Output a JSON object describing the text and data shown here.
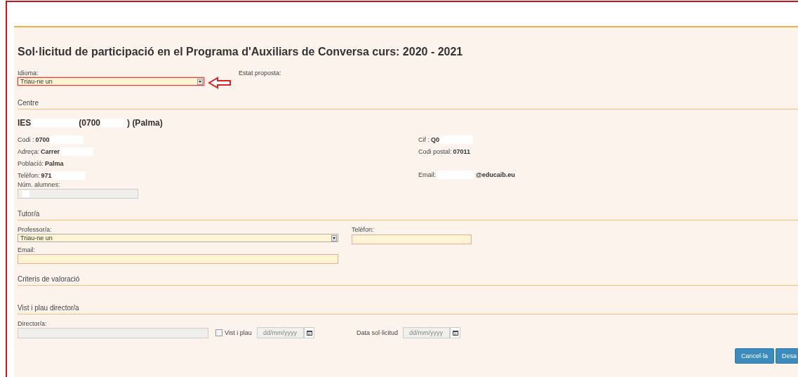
{
  "title": "Sol·licitud de participació en el Programa d'Auxiliars de Conversa curs: 2020 - 2021",
  "idioma": {
    "label": "Idioma:",
    "value": "Triau-ne un",
    "highlighted": true
  },
  "estat": {
    "label": "Estat proposta:"
  },
  "centre": {
    "heading": "Centre",
    "name_parts": [
      "IES",
      "(0700",
      ") (Palma)"
    ],
    "left": [
      {
        "label": "Codi :",
        "parts": [
          {
            "kind": "text",
            "text": "0700"
          },
          {
            "kind": "redaction"
          }
        ]
      },
      {
        "label": "Adreça:",
        "parts": [
          {
            "kind": "text",
            "text": "Carrer"
          },
          {
            "kind": "redaction"
          }
        ]
      },
      {
        "label": "Població:",
        "parts": [
          {
            "kind": "text",
            "text": "Palma"
          }
        ]
      },
      {
        "label": "Telèfon:",
        "parts": [
          {
            "kind": "text",
            "text": "971"
          },
          {
            "kind": "redaction"
          }
        ]
      }
    ],
    "right": [
      {
        "label": "Cif :",
        "parts": [
          {
            "kind": "text",
            "text": "Q0"
          },
          {
            "kind": "redaction"
          }
        ]
      },
      {
        "label": "Codi postal:",
        "parts": [
          {
            "kind": "text",
            "text": "07011"
          }
        ]
      },
      {
        "label": "Email:",
        "parts": [
          {
            "kind": "redaction"
          },
          {
            "kind": "text",
            "text": "@educaib.eu"
          }
        ]
      }
    ],
    "students": {
      "label": "Núm. alumnes:",
      "disabled": true
    }
  },
  "tutor": {
    "heading": "Tutor/a",
    "professor": {
      "label": "Professor/a:",
      "value": "Triau-ne un",
      "highlighted": false
    },
    "phone": {
      "label": "Telèfon:",
      "disabled": false
    },
    "email": {
      "label": "Email:",
      "disabled": false
    }
  },
  "criteria": {
    "heading": "Criteris de valoració"
  },
  "approval": {
    "heading": "Vist i plau director/a",
    "director": {
      "label": "Director/a:",
      "disabled": true
    },
    "checkbox": {
      "label": "Vist i plau",
      "checked": false
    },
    "date1": {
      "placeholder": "dd/mm/yyyy",
      "disabled": true
    },
    "request_date": {
      "label": "Data sol·licitud",
      "placeholder": "dd/mm/yyyy",
      "disabled": true
    }
  },
  "buttons": [
    {
      "label": "Cancel·la"
    },
    {
      "label": "Desa"
    }
  ]
}
